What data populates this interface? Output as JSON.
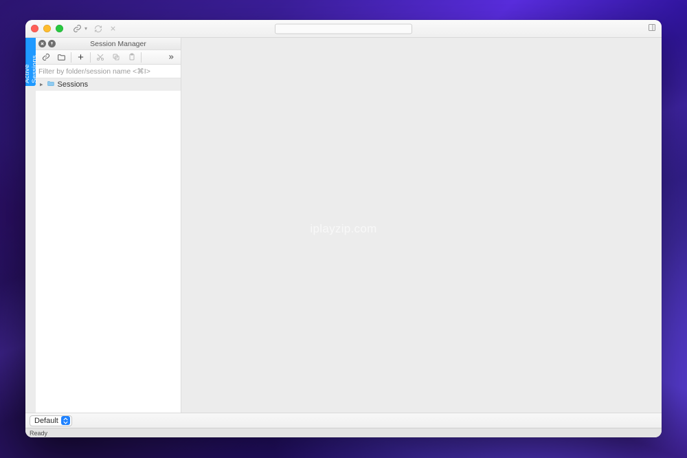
{
  "sidetab": {
    "label": "Active Sessions"
  },
  "panel": {
    "title": "Session Manager",
    "filter_placeholder": "Filter by folder/session name <⌘I>"
  },
  "tree": {
    "items": [
      {
        "label": "Sessions"
      }
    ]
  },
  "bottom": {
    "selector_value": "Default"
  },
  "status": {
    "text": "Ready"
  },
  "watermark": "iplayzip.com"
}
